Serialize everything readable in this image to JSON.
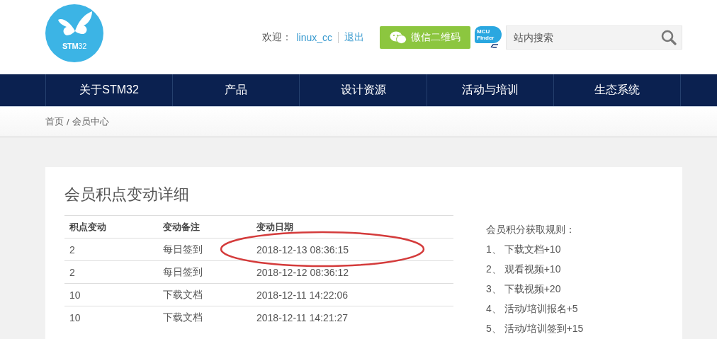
{
  "header": {
    "logo_text": "**STM**32",
    "welcome_label": "欢迎：",
    "username": "linux_cc",
    "logout": "退出",
    "wechat_button": "微信二维码",
    "mcu_finder": [
      "MCU",
      "Finder"
    ],
    "search": {
      "placeholder": "站内搜索"
    }
  },
  "nav": {
    "items": [
      {
        "label": "关于STM32"
      },
      {
        "label": "产品"
      },
      {
        "label": "设计资源"
      },
      {
        "label": "活动与培训"
      },
      {
        "label": "生态系统"
      }
    ]
  },
  "breadcrumb": {
    "items": [
      "首页",
      "会员中心"
    ],
    "separator": "/"
  },
  "card": {
    "title": "会员积点变动详细",
    "table": {
      "columns": [
        "积点变动",
        "变动备注",
        "变动日期"
      ],
      "rows": [
        [
          "2",
          "每日签到",
          "2018-12-13 08:36:15"
        ],
        [
          "2",
          "每日签到",
          "2018-12-12 08:36:12"
        ],
        [
          "10",
          "下载文档",
          "2018-12-11 14:22:06"
        ],
        [
          "10",
          "下载文档",
          "2018-12-11 14:21:27"
        ]
      ]
    },
    "rules": {
      "title": "会员积分获取规则：",
      "items": [
        "1、 下载文档+10",
        "2、 观看视频+10",
        "3、 下载视频+20",
        "4、 活动/培训报名+5",
        "5、 活动/培训签到+15"
      ]
    }
  }
}
